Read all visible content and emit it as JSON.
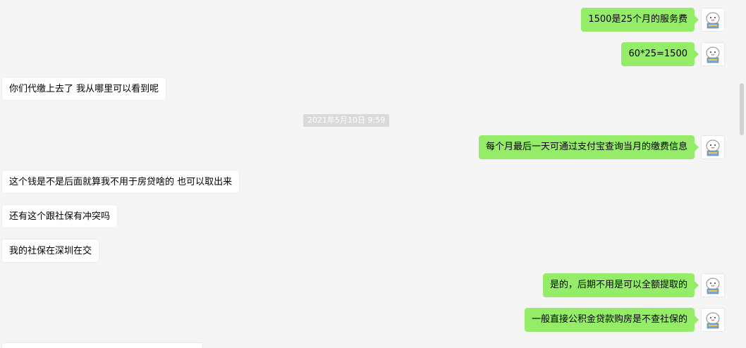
{
  "conversation": {
    "timestamp": "2021年5月10日 9:59",
    "messages": [
      {
        "side": "out",
        "text": "1500是25个月的服务费"
      },
      {
        "side": "out",
        "text": "60*25=1500"
      },
      {
        "side": "in",
        "text": "你们代缴上去了 我从哪里可以看到呢"
      },
      {
        "side": "out",
        "text": "每个月最后一天可通过支付宝查询当月的缴费信息"
      },
      {
        "side": "in",
        "text": "这个钱是不是后面就算我不用于房贷啥的 也可以取出来"
      },
      {
        "side": "in",
        "text": "还有这个跟社保有冲突吗"
      },
      {
        "side": "in",
        "text": "我的社保在深圳在交"
      },
      {
        "side": "out",
        "text": "是的，后期不用是可以全额提取的"
      },
      {
        "side": "out",
        "text": "一般直接公积金贷款购房是不查社保的"
      }
    ]
  },
  "colors": {
    "background": "#f5f5f5",
    "outgoing_bubble": "#95ec69",
    "incoming_bubble": "#ffffff",
    "timestamp_bg": "#dadada"
  },
  "icons": {
    "avatar": "cartoon-cat-avatar-icon"
  }
}
